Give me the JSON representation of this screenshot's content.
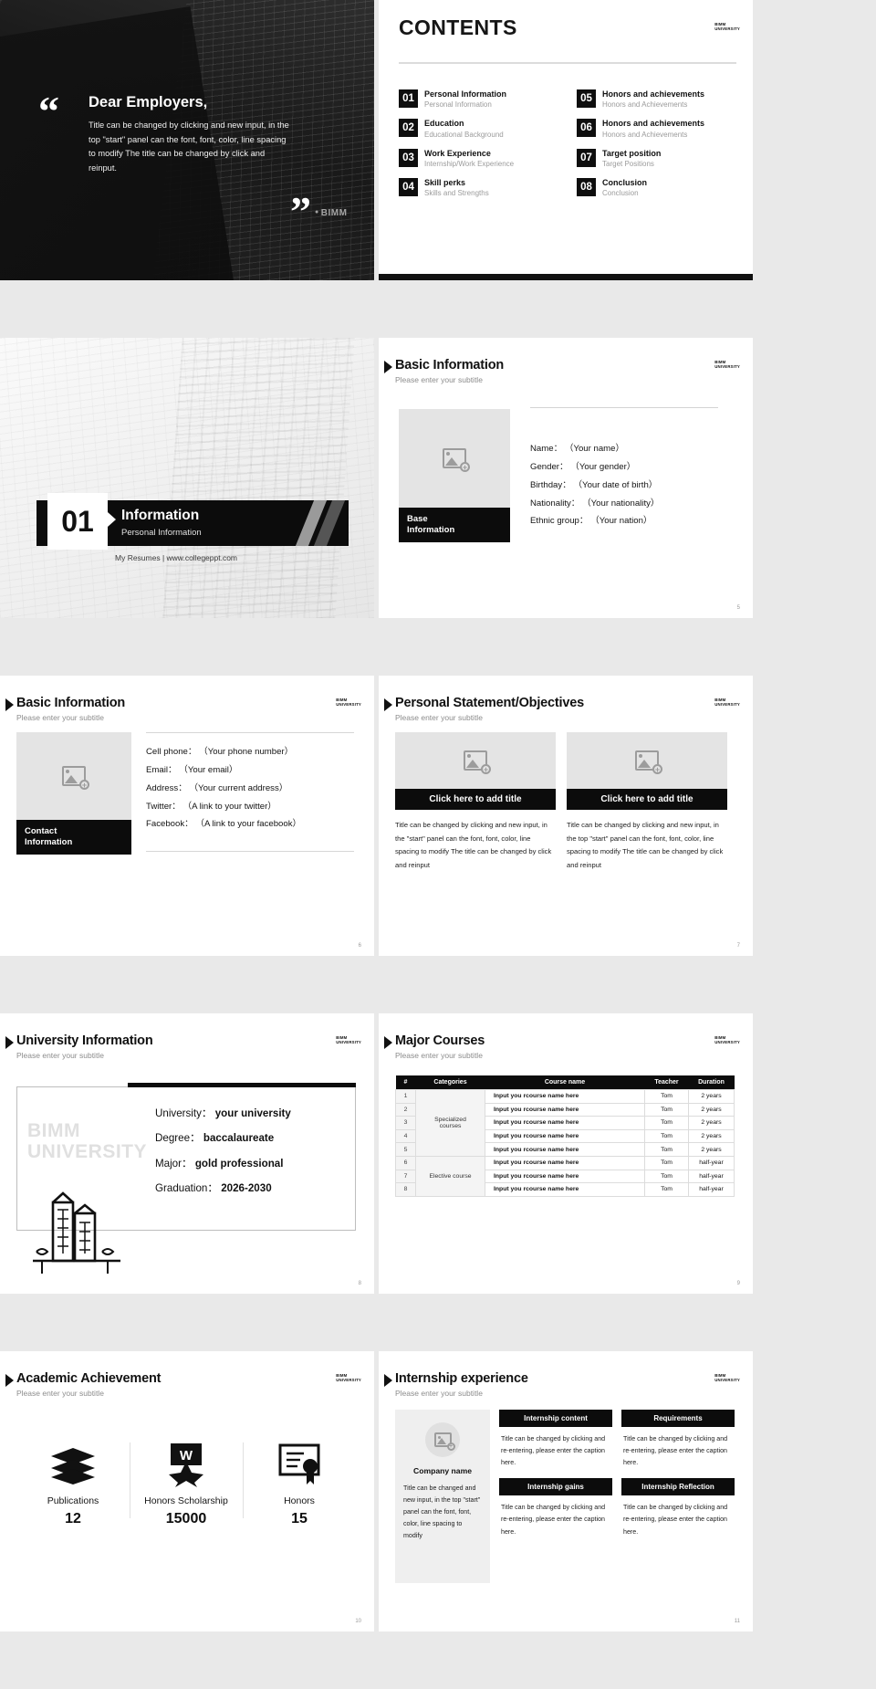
{
  "brand": {
    "logo_line1": "BIMM",
    "logo_line2": "UNIVERSITY"
  },
  "slide_quote": {
    "title": "Dear Employers,",
    "body": "Title can be changed by clicking and new input, in the top \"start\" panel can the font, font, color, line spacing to modify The title can be changed by click and reinput.",
    "watermark": "BIMM",
    "quote_open": "“",
    "quote_close": "”"
  },
  "slide_contents": {
    "title": "CONTENTS",
    "items": [
      {
        "num": "01",
        "title": "Personal Information",
        "sub": "Personal Information"
      },
      {
        "num": "05",
        "title": "Honors and achievements",
        "sub": "Honors and Achievements"
      },
      {
        "num": "02",
        "title": "Education",
        "sub": "Educational Background"
      },
      {
        "num": "06",
        "title": "Honors and achievements",
        "sub": "Honors and Achievements"
      },
      {
        "num": "03",
        "title": "Work Experience",
        "sub": "Internship/Work Experience"
      },
      {
        "num": "07",
        "title": "Target position",
        "sub": "Target Positions"
      },
      {
        "num": "04",
        "title": "Skill perks",
        "sub": "Skills and Strengths"
      },
      {
        "num": "08",
        "title": "Conclusion",
        "sub": "Conclusion"
      }
    ]
  },
  "slide_section": {
    "number": "01",
    "title": "Information",
    "subtitle": "Personal Information",
    "footer": "My Resumes | www.collegeppt.com"
  },
  "slide_basic": {
    "title": "Basic Information",
    "subtitle": "Please enter your subtitle",
    "photo_label": "Base\nInformation",
    "fields": [
      {
        "label": "Name：",
        "value": "（Your name）"
      },
      {
        "label": "Gender：",
        "value": "（Your gender）"
      },
      {
        "label": "Birthday：",
        "value": "（Your date of birth）"
      },
      {
        "label": "Nationality：",
        "value": "（Your nationality）"
      },
      {
        "label": "Ethnic group：",
        "value": "（Your nation）"
      }
    ],
    "page": "5"
  },
  "slide_contact": {
    "title": "Basic Information",
    "subtitle": "Please enter your subtitle",
    "photo_label": "Contact\nInformation",
    "fields": [
      {
        "label": "Cell phone：",
        "value": "（Your phone number）"
      },
      {
        "label": "Email：",
        "value": "（Your email）"
      },
      {
        "label": "Address：",
        "value": "（Your current address）"
      },
      {
        "label": "Twitter：",
        "value": "（A link to your twitter）"
      },
      {
        "label": "Facebook：",
        "value": "（A link to your facebook）"
      }
    ],
    "page": "6"
  },
  "slide_statement": {
    "title": "Personal Statement/Objectives",
    "subtitle": "Please enter your subtitle",
    "cards": [
      {
        "caption": "Click here to add title",
        "body": "Title can be changed by clicking and new input, in the \"start\" panel can the font, font, color, line spacing to modify The title can be changed by click and reinput"
      },
      {
        "caption": "Click here to add title",
        "body": "Title can be changed by clicking and new input, in the top \"start\" panel can the font, font, color, line spacing to modify The title can be changed by click and reinput"
      }
    ],
    "page": "7"
  },
  "slide_university": {
    "title": "University Information",
    "subtitle": "Please enter your subtitle",
    "watermark_line1": "BIMM",
    "watermark_line2": "UNIVERSITY",
    "rows": [
      {
        "label": "University：",
        "value": "your university"
      },
      {
        "label": "Degree：",
        "value": "baccalaureate"
      },
      {
        "label": "Major：",
        "value": "gold professional"
      },
      {
        "label": "Graduation：",
        "value": "2026-2030"
      }
    ],
    "page": "8"
  },
  "slide_courses": {
    "title": "Major Courses",
    "subtitle": "Please enter your subtitle",
    "columns": [
      "#",
      "Categories",
      "Course name",
      "Teacher",
      "Duration"
    ],
    "category_specialized": "Specialized\ncourses",
    "category_elective": "Elective course",
    "rows": [
      {
        "idx": "1",
        "name": "Input you rcourse name here",
        "teacher": "Tom",
        "duration": "2 years"
      },
      {
        "idx": "2",
        "name": "Input you rcourse name here",
        "teacher": "Tom",
        "duration": "2 years"
      },
      {
        "idx": "3",
        "name": "Input you rcourse name here",
        "teacher": "Tom",
        "duration": "2 years"
      },
      {
        "idx": "4",
        "name": "Input you rcourse name here",
        "teacher": "Tom",
        "duration": "2 years"
      },
      {
        "idx": "5",
        "name": "Input you rcourse name here",
        "teacher": "Tom",
        "duration": "2 years"
      },
      {
        "idx": "6",
        "name": "Input you rcourse name here",
        "teacher": "Tom",
        "duration": "half-year"
      },
      {
        "idx": "7",
        "name": "Input you rcourse name here",
        "teacher": "Tom",
        "duration": "half-year"
      },
      {
        "idx": "8",
        "name": "Input you rcourse name here",
        "teacher": "Tom",
        "duration": "half-year"
      }
    ],
    "page": "9"
  },
  "slide_academic": {
    "title": "Academic Achievement",
    "subtitle": "Please enter your subtitle",
    "stats": [
      {
        "icon": "books-icon",
        "label": "Publications",
        "value": "12"
      },
      {
        "icon": "medal-icon",
        "label": "Honors Scholarship",
        "value": "15000"
      },
      {
        "icon": "certificate-icon",
        "label": "Honors",
        "value": "15"
      }
    ],
    "page": "10"
  },
  "slide_internship": {
    "title": "Internship experience",
    "subtitle": "Please enter your subtitle",
    "company_name": "Company name",
    "company_body": "Title can be changed and new input, in the top \"start\" panel can the font, font, color, line spacing to modify",
    "cards": [
      {
        "heading": "Internship content",
        "body": "Title can be changed by clicking and re-entering, please enter the caption here."
      },
      {
        "heading": "Requirements",
        "body": "Title can be changed by clicking and re-entering, please enter the caption here."
      },
      {
        "heading": "Internship gains",
        "body": "Title can be changed by clicking and re-entering, please enter the caption here."
      },
      {
        "heading": "Internship Reflection",
        "body": "Title can be changed by clicking and re-entering, please enter the caption here."
      }
    ],
    "page": "11"
  }
}
